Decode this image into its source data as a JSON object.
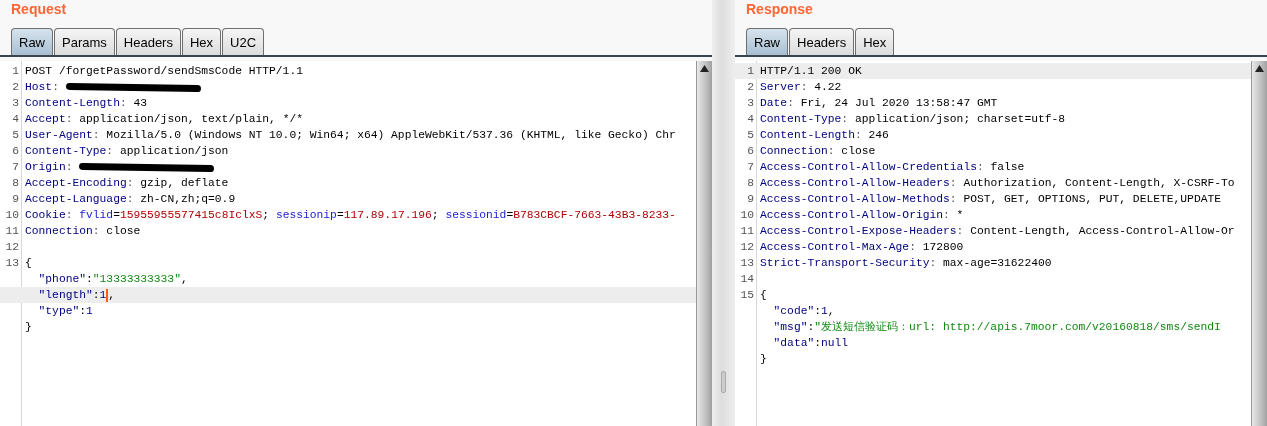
{
  "panes": [
    {
      "title": "Request",
      "tabs": [
        {
          "label": "Raw",
          "selected": true
        },
        {
          "label": "Params",
          "selected": false
        },
        {
          "label": "Headers",
          "selected": false
        },
        {
          "label": "Hex",
          "selected": false
        },
        {
          "label": "U2C",
          "selected": false
        }
      ],
      "lines": [
        {
          "number": "1",
          "highlighted": false,
          "segments": [
            {
              "kind": "text",
              "text": "POST /forgetPassword/sendSmsCode HTTP/1.1"
            }
          ]
        },
        {
          "number": "2",
          "highlighted": false,
          "segments": [
            {
              "kind": "header",
              "text": "Host"
            },
            {
              "kind": "sep",
              "text": ": "
            },
            {
              "kind": "redacted"
            }
          ]
        },
        {
          "number": "3",
          "highlighted": false,
          "segments": [
            {
              "kind": "header",
              "text": "Content-Length"
            },
            {
              "kind": "sep",
              "text": ": "
            },
            {
              "kind": "text",
              "text": "43"
            }
          ]
        },
        {
          "number": "4",
          "highlighted": false,
          "segments": [
            {
              "kind": "header",
              "text": "Accept"
            },
            {
              "kind": "sep",
              "text": ": "
            },
            {
              "kind": "text",
              "text": "application/json, text/plain, */*"
            }
          ]
        },
        {
          "number": "5",
          "highlighted": false,
          "segments": [
            {
              "kind": "header",
              "text": "User-Agent"
            },
            {
              "kind": "sep",
              "text": ": "
            },
            {
              "kind": "text",
              "text": "Mozilla/5.0 (Windows NT 10.0; Win64; x64) AppleWebKit/537.36 (KHTML, like Gecko) Chr"
            }
          ]
        },
        {
          "number": "6",
          "highlighted": false,
          "segments": [
            {
              "kind": "header",
              "text": "Content-Type"
            },
            {
              "kind": "sep",
              "text": ": "
            },
            {
              "kind": "text",
              "text": "application/json"
            }
          ]
        },
        {
          "number": "7",
          "highlighted": false,
          "segments": [
            {
              "kind": "header",
              "text": "Origin"
            },
            {
              "kind": "sep",
              "text": ": "
            },
            {
              "kind": "redacted"
            }
          ]
        },
        {
          "number": "8",
          "highlighted": false,
          "segments": [
            {
              "kind": "header",
              "text": "Accept-Encoding"
            },
            {
              "kind": "sep",
              "text": ": "
            },
            {
              "kind": "text",
              "text": "gzip, deflate"
            }
          ]
        },
        {
          "number": "9",
          "highlighted": false,
          "segments": [
            {
              "kind": "header",
              "text": "Accept-Language"
            },
            {
              "kind": "sep",
              "text": ": "
            },
            {
              "kind": "text",
              "text": "zh-CN,zh;q=0.9"
            }
          ]
        },
        {
          "number": "10",
          "highlighted": false,
          "segments": [
            {
              "kind": "header",
              "text": "Cookie"
            },
            {
              "kind": "sep",
              "text": ": "
            },
            {
              "kind": "param",
              "text": "fvlid"
            },
            {
              "kind": "text",
              "text": "="
            },
            {
              "kind": "pvalue",
              "text": "15955955577415c8IclxS"
            },
            {
              "kind": "text",
              "text": "; "
            },
            {
              "kind": "param",
              "text": "sessionip"
            },
            {
              "kind": "text",
              "text": "="
            },
            {
              "kind": "pvalue",
              "text": "117.89.17.196"
            },
            {
              "kind": "text",
              "text": "; "
            },
            {
              "kind": "param",
              "text": "sessionid"
            },
            {
              "kind": "text",
              "text": "="
            },
            {
              "kind": "pvalue",
              "text": "B783CBCF-7663-43B3-8233-"
            }
          ]
        },
        {
          "number": "11",
          "highlighted": false,
          "segments": [
            {
              "kind": "header",
              "text": "Connection"
            },
            {
              "kind": "sep",
              "text": ": "
            },
            {
              "kind": "text",
              "text": "close"
            }
          ]
        },
        {
          "number": "12",
          "highlighted": false
        },
        {
          "number": "13",
          "highlighted": false,
          "segments": [
            {
              "kind": "text",
              "text": "{"
            }
          ]
        },
        {
          "highlighted": false,
          "indented": true,
          "segments": [
            {
              "kind": "jkey",
              "text": "\"phone\""
            },
            {
              "kind": "text",
              "text": ":"
            },
            {
              "kind": "jstr",
              "text": "\"13333333333\""
            },
            {
              "kind": "text",
              "text": ","
            }
          ]
        },
        {
          "highlighted": true,
          "indented": true,
          "segments": [
            {
              "kind": "jkey",
              "text": "\"length\""
            },
            {
              "kind": "text",
              "text": ":"
            },
            {
              "kind": "jnum",
              "text": "1"
            },
            {
              "kind": "caret"
            },
            {
              "kind": "text",
              "text": ","
            }
          ]
        },
        {
          "highlighted": false,
          "indented": true,
          "segments": [
            {
              "kind": "jkey",
              "text": "\"type\""
            },
            {
              "kind": "text",
              "text": ":"
            },
            {
              "kind": "jnum",
              "text": "1"
            }
          ]
        },
        {
          "highlighted": false,
          "segments": [
            {
              "kind": "text",
              "text": "}"
            }
          ]
        }
      ]
    },
    {
      "title": "Response",
      "tabs": [
        {
          "label": "Raw",
          "selected": true
        },
        {
          "label": "Headers",
          "selected": false
        },
        {
          "label": "Hex",
          "selected": false
        }
      ],
      "lines": [
        {
          "number": "1",
          "highlighted": true,
          "segments": [
            {
              "kind": "text",
              "text": "HTTP/1.1 200 OK"
            }
          ]
        },
        {
          "number": "2",
          "highlighted": false,
          "segments": [
            {
              "kind": "header",
              "text": "Server"
            },
            {
              "kind": "sep",
              "text": ": "
            },
            {
              "kind": "text",
              "text": "4.22"
            }
          ]
        },
        {
          "number": "3",
          "highlighted": false,
          "segments": [
            {
              "kind": "header",
              "text": "Date"
            },
            {
              "kind": "sep",
              "text": ": "
            },
            {
              "kind": "text",
              "text": "Fri, 24 Jul 2020 13:58:47 GMT"
            }
          ]
        },
        {
          "number": "4",
          "highlighted": false,
          "segments": [
            {
              "kind": "header",
              "text": "Content-Type"
            },
            {
              "kind": "sep",
              "text": ": "
            },
            {
              "kind": "text",
              "text": "application/json; charset=utf-8"
            }
          ]
        },
        {
          "number": "5",
          "highlighted": false,
          "segments": [
            {
              "kind": "header",
              "text": "Content-Length"
            },
            {
              "kind": "sep",
              "text": ": "
            },
            {
              "kind": "text",
              "text": "246"
            }
          ]
        },
        {
          "number": "6",
          "highlighted": false,
          "segments": [
            {
              "kind": "header",
              "text": "Connection"
            },
            {
              "kind": "sep",
              "text": ": "
            },
            {
              "kind": "text",
              "text": "close"
            }
          ]
        },
        {
          "number": "7",
          "highlighted": false,
          "segments": [
            {
              "kind": "header",
              "text": "Access-Control-Allow-Credentials"
            },
            {
              "kind": "sep",
              "text": ": "
            },
            {
              "kind": "text",
              "text": "false"
            }
          ]
        },
        {
          "number": "8",
          "highlighted": false,
          "segments": [
            {
              "kind": "header",
              "text": "Access-Control-Allow-Headers"
            },
            {
              "kind": "sep",
              "text": ": "
            },
            {
              "kind": "text",
              "text": "Authorization, Content-Length, X-CSRF-To"
            }
          ]
        },
        {
          "number": "9",
          "highlighted": false,
          "segments": [
            {
              "kind": "header",
              "text": "Access-Control-Allow-Methods"
            },
            {
              "kind": "sep",
              "text": ": "
            },
            {
              "kind": "text",
              "text": "POST, GET, OPTIONS, PUT, DELETE,UPDATE"
            }
          ]
        },
        {
          "number": "10",
          "highlighted": false,
          "segments": [
            {
              "kind": "header",
              "text": "Access-Control-Allow-Origin"
            },
            {
              "kind": "sep",
              "text": ": "
            },
            {
              "kind": "text",
              "text": "*"
            }
          ]
        },
        {
          "number": "11",
          "highlighted": false,
          "segments": [
            {
              "kind": "header",
              "text": "Access-Control-Expose-Headers"
            },
            {
              "kind": "sep",
              "text": ": "
            },
            {
              "kind": "text",
              "text": "Content-Length, Access-Control-Allow-Or"
            }
          ]
        },
        {
          "number": "12",
          "highlighted": false,
          "segments": [
            {
              "kind": "header",
              "text": "Access-Control-Max-Age"
            },
            {
              "kind": "sep",
              "text": ": "
            },
            {
              "kind": "text",
              "text": "172800"
            }
          ]
        },
        {
          "number": "13",
          "highlighted": false,
          "segments": [
            {
              "kind": "header",
              "text": "Strict-Transport-Security"
            },
            {
              "kind": "sep",
              "text": ": "
            },
            {
              "kind": "text",
              "text": "max-age=31622400"
            }
          ]
        },
        {
          "number": "14",
          "highlighted": false
        },
        {
          "number": "15",
          "highlighted": false,
          "segments": [
            {
              "kind": "text",
              "text": "{"
            }
          ]
        },
        {
          "highlighted": false,
          "indented": true,
          "segments": [
            {
              "kind": "jkey",
              "text": "\"code\""
            },
            {
              "kind": "text",
              "text": ":"
            },
            {
              "kind": "jnum",
              "text": "1"
            },
            {
              "kind": "text",
              "text": ","
            }
          ]
        },
        {
          "highlighted": false,
          "indented": true,
          "segments": [
            {
              "kind": "jkey",
              "text": "\"msg\""
            },
            {
              "kind": "text",
              "text": ":"
            },
            {
              "kind": "jstr",
              "text": "\"发送短信验证码：url: http://apis.7moor.com/v20160818/sms/sendI"
            }
          ]
        },
        {
          "highlighted": false,
          "indented": true,
          "segments": [
            {
              "kind": "jkey",
              "text": "\"data\""
            },
            {
              "kind": "text",
              "text": ":"
            },
            {
              "kind": "jnum",
              "text": "null"
            }
          ]
        },
        {
          "highlighted": false,
          "segments": [
            {
              "kind": "text",
              "text": "}"
            }
          ]
        }
      ]
    }
  ]
}
